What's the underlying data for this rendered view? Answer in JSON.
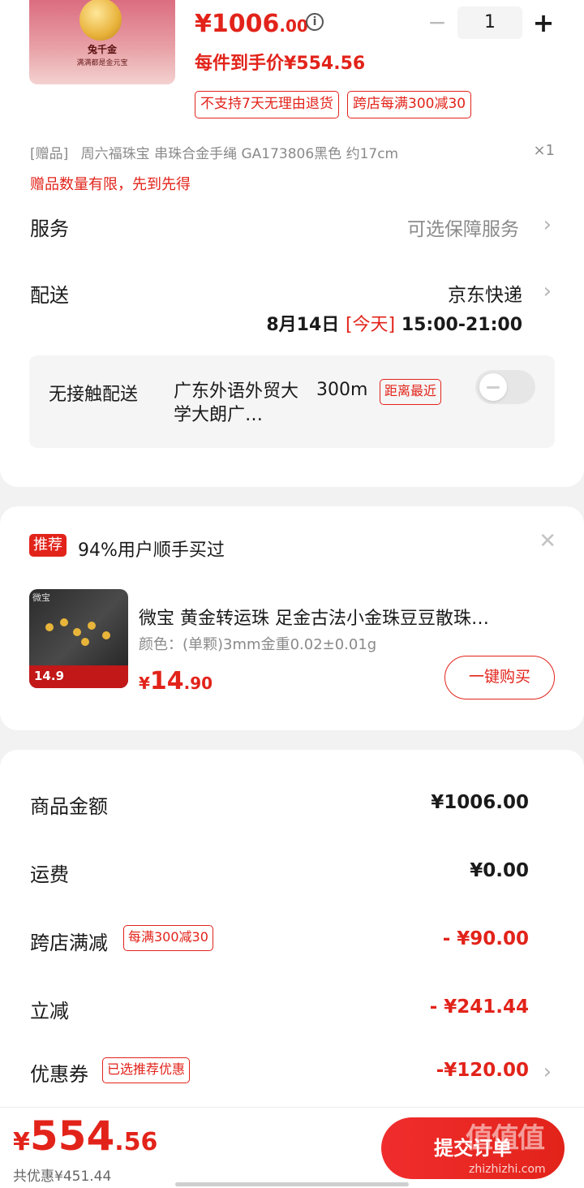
{
  "product": {
    "image_caption": "兔千金",
    "image_subcaption": "满满都是金元宝",
    "price_main": "¥1006",
    "price_decimal": ".00",
    "info_icon": "info-icon",
    "qty_minus": "−",
    "qty_value": "1",
    "qty_plus": "+",
    "final_price_text": "每件到手价¥554.56",
    "tags": [
      "不支持7天无理由退货",
      "跨店每满300减30"
    ]
  },
  "gift": {
    "prefix": "[赠品]",
    "name": "周六福珠宝 串珠合金手绳 GA173806黑色 约17cm",
    "qty": "×1",
    "notice": "赠品数量有限，先到先得"
  },
  "service": {
    "label": "服务",
    "value": "可选保障服务"
  },
  "delivery": {
    "label": "配送",
    "carrier": "京东快递",
    "date": "8月14日",
    "today": "[今天]",
    "time": "15:00-21:00"
  },
  "contactless": {
    "label": "无接触配送",
    "location": "广东外语外贸大学大朗广…",
    "distance": "300m",
    "badge": "距离最近",
    "toggle_on": false
  },
  "recommend": {
    "badge": "推荐",
    "title": "94%用户顺手买过",
    "close_icon": "close-icon",
    "item_name": "微宝 黄金转运珠 足金古法小金珠豆豆散珠…",
    "item_spec": "颜色：(单颗)3mm金重0.02±0.01g",
    "price_int": "14",
    "price_dec": ".90",
    "price_symbol": "¥",
    "buy_button": "一键购买",
    "thumb_brand": "微宝",
    "thumb_price": "14.9"
  },
  "summary": {
    "rows": [
      {
        "label": "商品金额",
        "value": "¥1006.00",
        "tag": ""
      },
      {
        "label": "运费",
        "value": "¥0.00",
        "tag": ""
      },
      {
        "label": "跨店满减",
        "value": "- ¥90.00",
        "tag": "每满300减30"
      },
      {
        "label": "立减",
        "value": "- ¥241.44",
        "tag": ""
      },
      {
        "label": "优惠券",
        "value": "-¥120.00",
        "tag": "已选推荐优惠"
      }
    ]
  },
  "footer": {
    "currency": "¥",
    "total_int": "554",
    "total_dec": ".56",
    "saved": "共优惠¥451.44",
    "submit": "提交订单",
    "watermark": "值值值",
    "watermark_url": "zhizhizhi.com"
  },
  "colors": {
    "accent": "#e2231a",
    "background": "#f2f2f2",
    "card": "#ffffff"
  }
}
